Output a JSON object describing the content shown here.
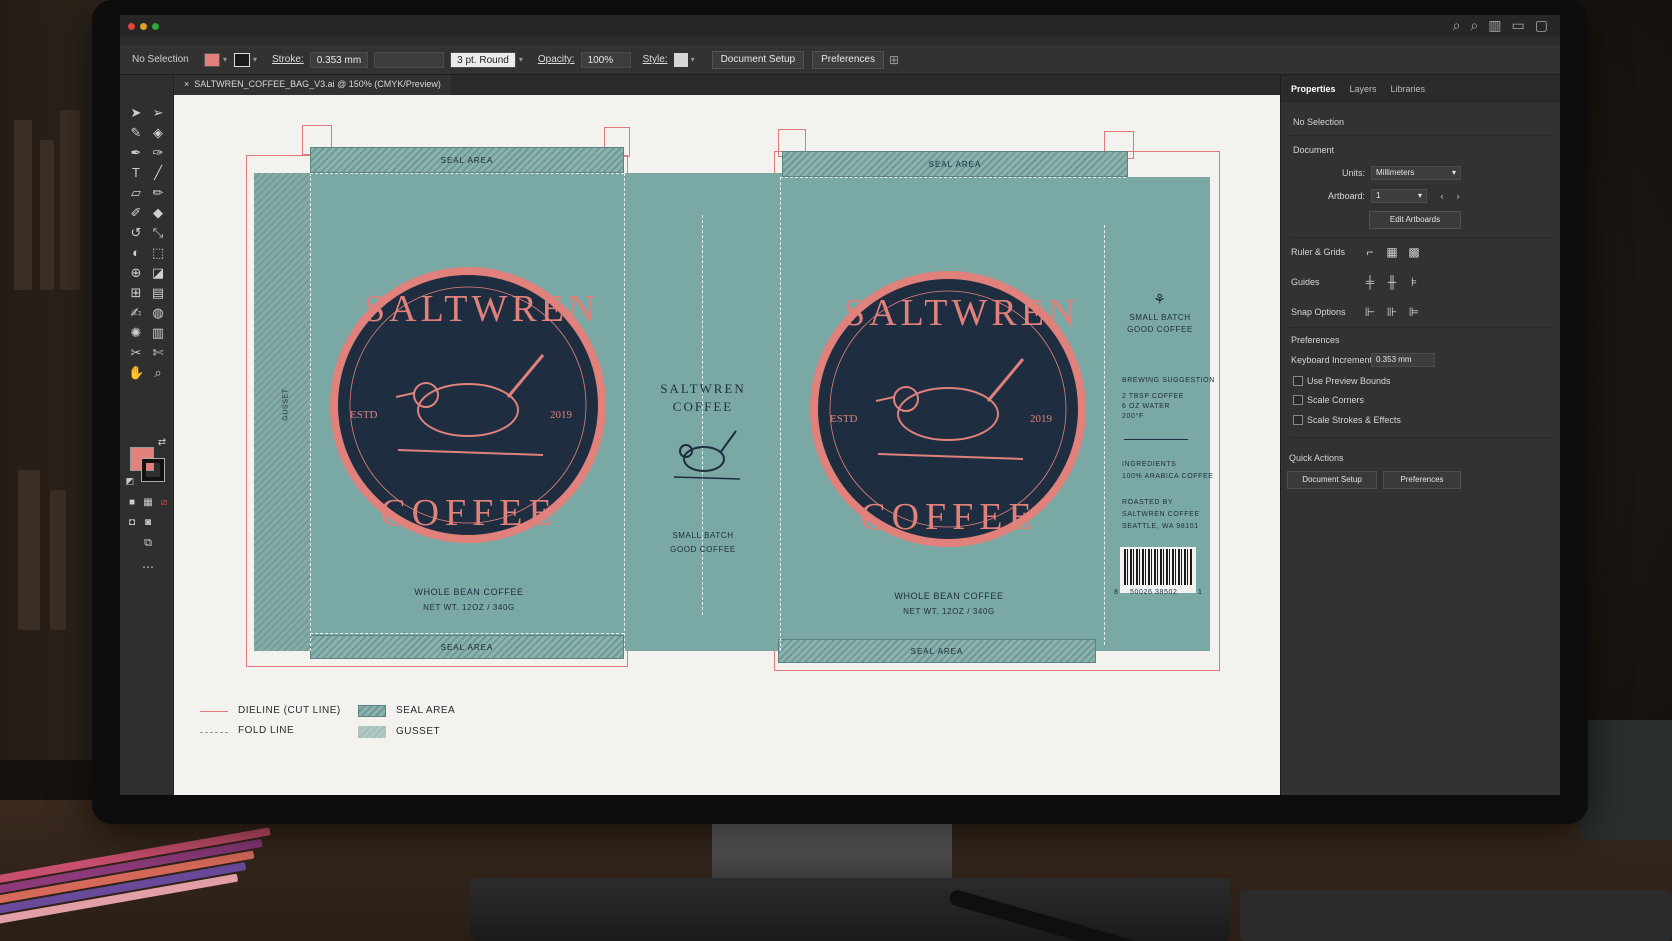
{
  "app": {
    "document_tab": "SALTWREN_COFFEE_BAG_V3.ai @ 150% (CMYK/Preview)",
    "fill_color": "#e0817c"
  },
  "control_bar": {
    "selection": "No Selection",
    "stroke_label": "Stroke:",
    "stroke_value": "0.353 mm",
    "brush_value": "3 pt. Round",
    "opacity_label": "Opacity:",
    "opacity_value": "100%",
    "style_label": "Style:",
    "document_setup": "Document Setup",
    "preferences": "Preferences"
  },
  "properties_panel": {
    "tabs": [
      "Properties",
      "Layers",
      "Libraries"
    ],
    "selection": "No Selection",
    "document_heading": "Document",
    "units_label": "Units:",
    "units_value": "Millimeters",
    "artboard_label": "Artboard:",
    "artboard_value": "1",
    "edit_artboards": "Edit Artboards",
    "ruler_grids": "Ruler & Grids",
    "guides": "Guides",
    "snap_options": "Snap Options",
    "preferences_heading": "Preferences",
    "keyboard_increment_label": "Keyboard Increment:",
    "keyboard_increment_value": "0.353 mm",
    "use_preview_bounds": "Use Preview Bounds",
    "scale_corners": "Scale Corners",
    "scale_strokes": "Scale Strokes & Effects",
    "quick_actions": "Quick Actions",
    "qa_document_setup": "Document Setup",
    "qa_preferences": "Preferences"
  },
  "artwork": {
    "seal_area": "SEAL AREA",
    "gusset": "GUSSET",
    "badge_top": "SALTWREN",
    "badge_bottom": "COFFEE",
    "estd": "ESTD",
    "year": "2019",
    "whole_bean": "WHOLE BEAN COFFEE",
    "net_wt": "NET WT. 12OZ / 340G",
    "center_brand_1": "SALTWREN",
    "center_brand_2": "COFFEE",
    "small_batch_1": "SMALL BATCH",
    "small_batch_2": "GOOD COFFEE",
    "brewing_heading": "BREWING SUGGESTION",
    "brewing_1": "2 TBSP COFFEE",
    "brewing_2": "6 OZ WATER",
    "brewing_3": "200°F",
    "ingredients_heading": "INGREDIENTS",
    "ingredients_1": "100% ARABICA COFFEE",
    "roasted_1": "ROASTED BY",
    "roasted_2": "SALTWREN COFFEE",
    "roasted_3": "SEATTLE, WA 98101",
    "barcode_left": "8",
    "barcode_mid": "50026 38502",
    "barcode_right": "1"
  },
  "legend": {
    "dieline": "DIELINE (CUT LINE)",
    "fold": "FOLD LINE",
    "seal": "SEAL AREA",
    "gusset": "GUSSET"
  },
  "colors": {
    "teal": "#7aa8a4",
    "navy": "#1f2d40",
    "salmon": "#e0817c",
    "dieline": "#e07a7a"
  }
}
